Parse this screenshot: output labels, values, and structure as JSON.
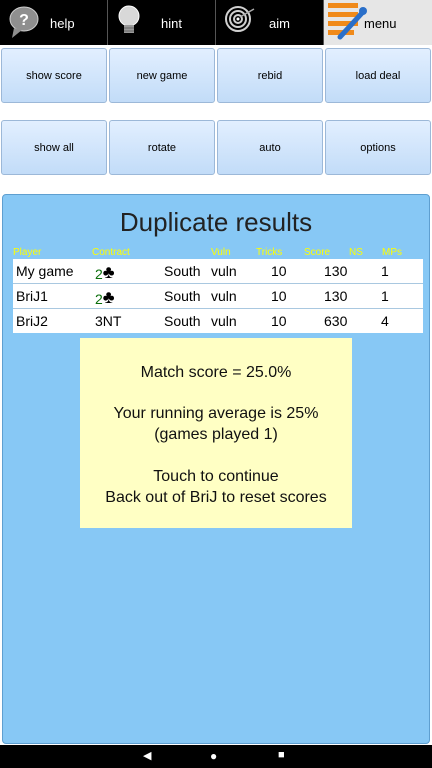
{
  "tabs": [
    {
      "label": "help",
      "icon": "speech-bubble-question-icon"
    },
    {
      "label": "hint",
      "icon": "lightbulb-icon"
    },
    {
      "label": "aim",
      "icon": "target-icon"
    },
    {
      "label": "menu",
      "icon": "menu-tools-icon"
    }
  ],
  "buttons_row1": [
    "show score",
    "new game",
    "rebid",
    "load deal"
  ],
  "buttons_row2": [
    "show all",
    "rotate",
    "auto",
    "options"
  ],
  "results": {
    "title": "Duplicate results",
    "headers": [
      "Player",
      "Contract",
      "Vuln",
      "Tricks",
      "Score",
      "NS",
      "MPs"
    ],
    "rows": [
      {
        "player": "My game",
        "contract_num": "2",
        "contract_suit": "♣",
        "declarer": "South",
        "vuln": "vuln",
        "tricks": "10",
        "score": "130",
        "mps": "1"
      },
      {
        "player": "BriJ1",
        "contract_num": "2",
        "contract_suit": "♣",
        "declarer": "South",
        "vuln": "vuln",
        "tricks": "10",
        "score": "130",
        "mps": "1"
      },
      {
        "player": "BriJ2",
        "contract_num": "3NT",
        "contract_suit": "",
        "declarer": "South",
        "vuln": "vuln",
        "tricks": "10",
        "score": "630",
        "mps": "4"
      }
    ]
  },
  "popup": {
    "match_score": "Match score = 25.0%",
    "running_average": "Your running average is 25%",
    "games_played": "(games played 1)",
    "touch": "Touch to continue",
    "back_out": "Back out of BriJ to reset scores"
  },
  "nav": {
    "back": "◀",
    "home": "●",
    "recent": "■"
  },
  "colors": {
    "panel": "#87c8f5",
    "header_text": "#ffff00",
    "popup": "#ffffc4",
    "button": "#cfe4fb"
  }
}
